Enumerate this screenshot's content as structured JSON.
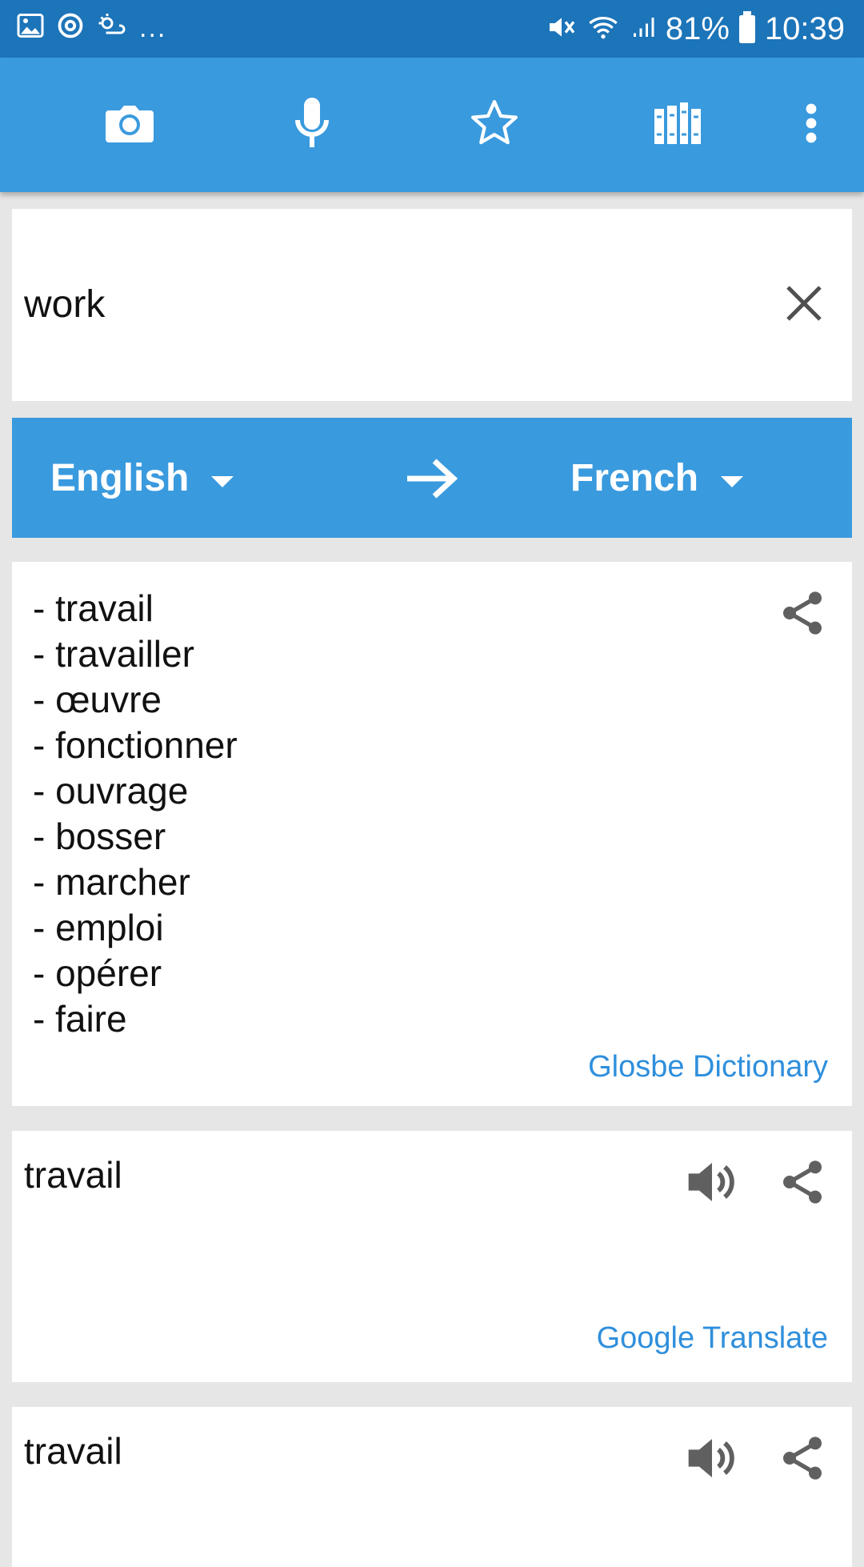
{
  "status_bar": {
    "dots": "...",
    "battery": "81%",
    "time": "10:39"
  },
  "toolbar": {
    "icons": [
      "camera-icon",
      "microphone-icon",
      "star-icon",
      "library-icon",
      "more-vert-icon"
    ]
  },
  "input": {
    "value": "work"
  },
  "languages": {
    "source": "English",
    "target": "French"
  },
  "dictionary": {
    "translations": [
      "- travail",
      "- travailler",
      "- œuvre",
      "- fonctionner",
      "- ouvrage",
      "- bosser",
      "- marcher",
      "- emploi",
      "- opérer",
      "- faire"
    ],
    "source": "Glosbe Dictionary"
  },
  "results": [
    {
      "text": "travail",
      "source": "Google Translate"
    },
    {
      "text": "travail"
    }
  ],
  "colors": {
    "status_bar": "#1c74b9",
    "primary": "#3a9ade",
    "link": "#2f8fdc",
    "background": "#e6e6e6",
    "icon_gray": "#606060"
  }
}
